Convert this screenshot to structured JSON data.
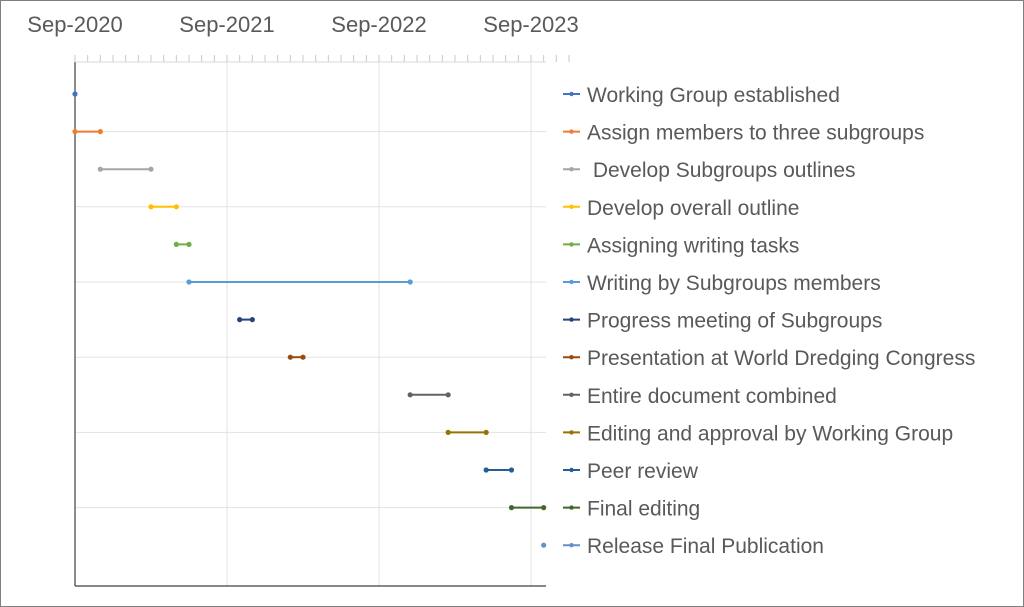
{
  "chart_data": {
    "type": "timeline",
    "x_axis_position": "top",
    "x_ticks": [
      "Sep-2020",
      "Sep-2021",
      "Sep-2022",
      "Sep-2023"
    ],
    "x_range": [
      "2020-09-01",
      "2023-12-01"
    ],
    "gridlines": true,
    "legend_placement": "right",
    "series": [
      {
        "name": "Working Group established",
        "start": "2020-09-01",
        "end": "2020-09-01",
        "color": "#4472c4"
      },
      {
        "name": "Assign members to three subgroups",
        "start": "2020-09-01",
        "end": "2020-11-01",
        "color": "#ed7d31"
      },
      {
        "name": " Develop Subgroups outlines",
        "start": "2020-11-01",
        "end": "2021-03-01",
        "color": "#a5a5a5"
      },
      {
        "name": "Develop overall outline",
        "start": "2021-03-01",
        "end": "2021-05-01",
        "color": "#ffc000"
      },
      {
        "name": "Assigning writing tasks",
        "start": "2021-05-01",
        "end": "2021-06-01",
        "color": "#70ad47"
      },
      {
        "name": "Writing by Subgroups members",
        "start": "2021-06-01",
        "end": "2022-11-15",
        "color": "#5b9bd5"
      },
      {
        "name": "Progress meeting of Subgroups",
        "start": "2021-10-01",
        "end": "2021-11-01",
        "color": "#264478"
      },
      {
        "name": "Presentation at World Dredging Congress",
        "start": "2022-02-01",
        "end": "2022-03-01",
        "color": "#9e480e"
      },
      {
        "name": "Entire document combined",
        "start": "2022-11-15",
        "end": "2023-02-15",
        "color": "#636363"
      },
      {
        "name": "Editing and approval by Working Group",
        "start": "2023-02-15",
        "end": "2023-05-15",
        "color": "#997300"
      },
      {
        "name": "Peer review",
        "start": "2023-05-15",
        "end": "2023-07-15",
        "color": "#255e91"
      },
      {
        "name": "Final editing",
        "start": "2023-07-15",
        "end": "2023-10-01",
        "color": "#43682b"
      },
      {
        "name": "Release Final Publication",
        "start": "2023-10-01",
        "end": "2023-10-01",
        "color": "#698ed0"
      }
    ]
  }
}
